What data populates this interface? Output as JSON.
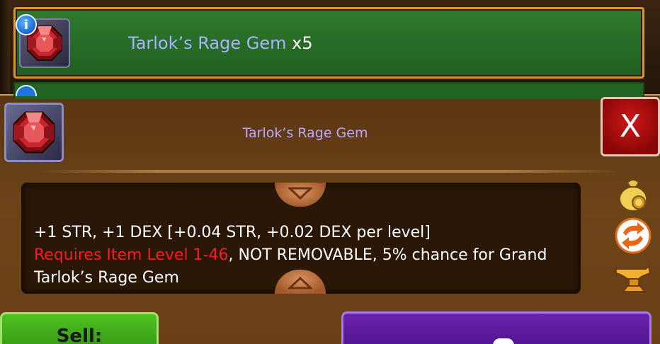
{
  "list": {
    "rows": [
      {
        "name": "Tarlok’s Rage Gem",
        "quantity": "x5",
        "info_badge": "i",
        "icon": "red-gem-icon"
      }
    ]
  },
  "detail": {
    "title": "Tarlok’s Rage Gem",
    "close_label": "X",
    "description": {
      "line1": "+1 STR, +1 DEX [+0.04 STR, +0.02 DEX per level]",
      "requirement": "Requires Item Level 1-46",
      "rest": ", NOT REMOVABLE, 5% chance for Grand Tarlok’s Rage Gem"
    },
    "side_actions": [
      "money-bag-icon",
      "transmute-icon",
      "anvil-icon"
    ]
  },
  "actions": {
    "sell_label": "Sell:"
  },
  "colors": {
    "row_green": "#2f7a2f",
    "row_border": "#d89a22",
    "name_color": "#a8b4ff",
    "requirement_red": "#ff1a1a",
    "close_red": "#c41010",
    "sell_green": "#45b01a",
    "purple": "#5a1a9e"
  }
}
